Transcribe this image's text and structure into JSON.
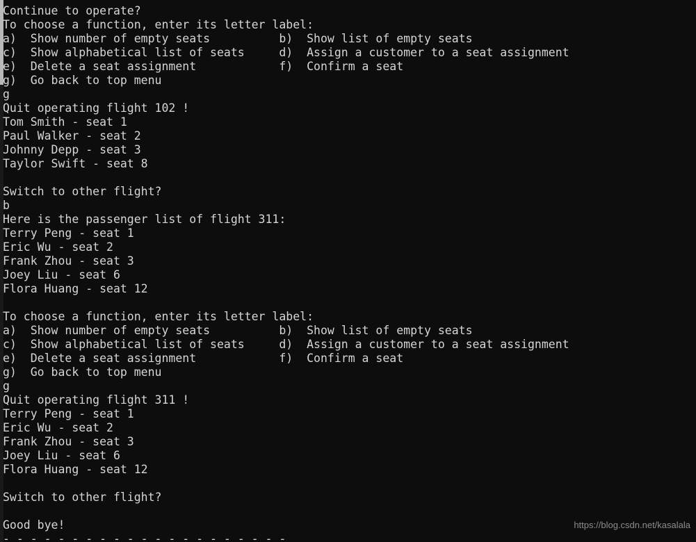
{
  "terminal": {
    "background_color": "#0d0d0d",
    "text_color": "#d6d6d6",
    "scrollbar": {
      "thumb_color": "#b9b9b9",
      "track_color": "#1a1a1a"
    },
    "lines": [
      "Continue to operate?",
      "To choose a function, enter its letter label:",
      "a)  Show number of empty seats          b)  Show list of empty seats",
      "c)  Show alphabetical list of seats     d)  Assign a customer to a seat assignment",
      "e)  Delete a seat assignment            f)  Confirm a seat",
      "g)  Go back to top menu",
      "g",
      "Quit operating flight 102 !",
      "Tom Smith - seat 1",
      "Paul Walker - seat 2",
      "Johnny Depp - seat 3",
      "Taylor Swift - seat 8",
      "",
      "Switch to other flight?",
      "b",
      "Here is the passenger list of flight 311:",
      "Terry Peng - seat 1",
      "Eric Wu - seat 2",
      "Frank Zhou - seat 3",
      "Joey Liu - seat 6",
      "Flora Huang - seat 12",
      "",
      "To choose a function, enter its letter label:",
      "a)  Show number of empty seats          b)  Show list of empty seats",
      "c)  Show alphabetical list of seats     d)  Assign a customer to a seat assignment",
      "e)  Delete a seat assignment            f)  Confirm a seat",
      "g)  Go back to top menu",
      "g",
      "Quit operating flight 311 !",
      "Terry Peng - seat 1",
      "Eric Wu - seat 2",
      "Frank Zhou - seat 3",
      "Joey Liu - seat 6",
      "Flora Huang - seat 12",
      "",
      "Switch to other flight?",
      "",
      "Good bye!",
      "- - - - - - - - - - - - - - - - - - - - -"
    ]
  },
  "watermark": {
    "text": "https://blog.csdn.net/kasalala"
  }
}
